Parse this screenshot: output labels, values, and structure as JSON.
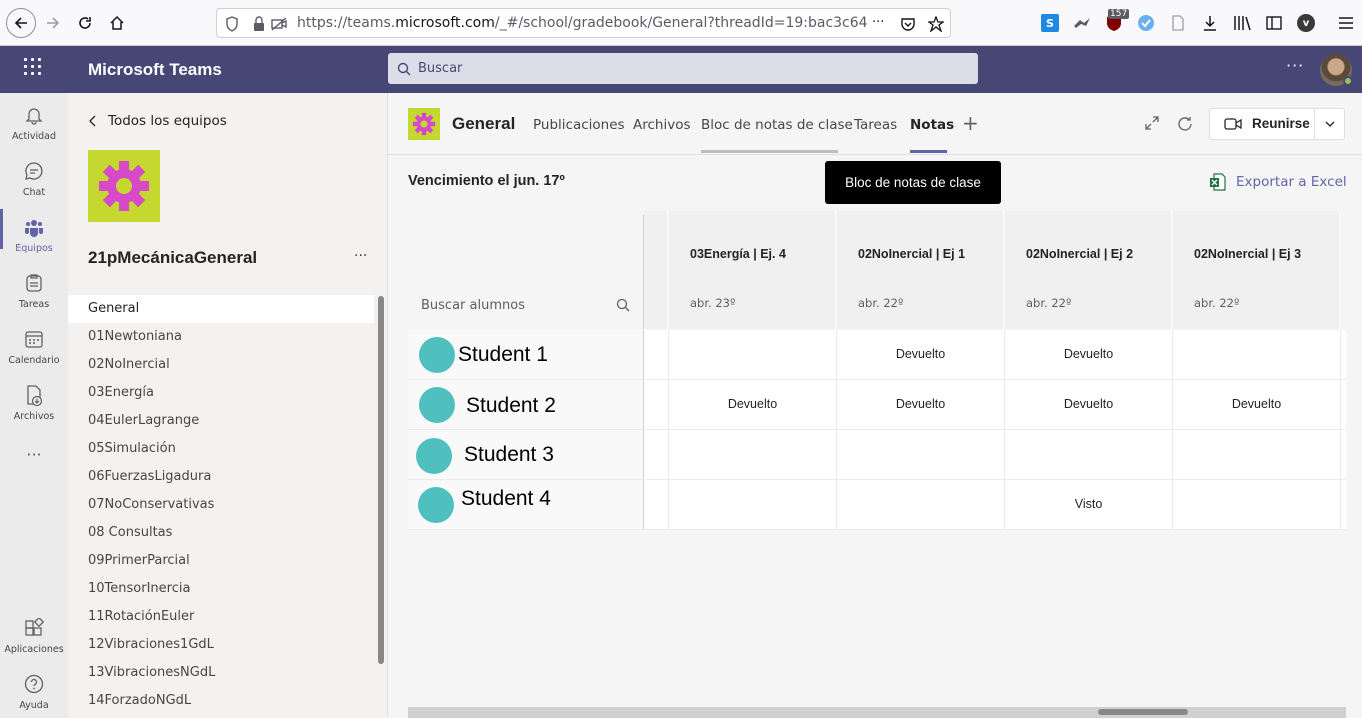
{
  "browser": {
    "url_scheme": "https://teams.",
    "url_domain": "microsoft.com",
    "url_path": "/_#/school/gradebook/General?threadId=19:bac3c64",
    "url_more": "···",
    "badge_count": "157"
  },
  "header": {
    "app_title": "Microsoft Teams",
    "search_placeholder": "Buscar",
    "more": "···"
  },
  "rail": {
    "items": [
      {
        "label": "Actividad"
      },
      {
        "label": "Chat"
      },
      {
        "label": "Equipos"
      },
      {
        "label": "Tareas"
      },
      {
        "label": "Calendario"
      },
      {
        "label": "Archivos"
      },
      {
        "label": "···"
      },
      {
        "label": "Aplicaciones"
      },
      {
        "label": "Ayuda"
      }
    ]
  },
  "team_panel": {
    "back_label": "Todos los equipos",
    "team_name": "21pMecánicaGeneral",
    "more": "···",
    "channels": [
      "General",
      "01Newtoniana",
      "02NoInercial",
      "03Energía",
      "04EulerLagrange",
      "05Simulación",
      "06FuerzasLigadura",
      "07NoConservativas",
      "08 Consultas",
      "09PrimerParcial",
      "10TensorInercia",
      "11RotaciónEuler",
      "12Vibraciones1GdL",
      "13VibracionesNGdL",
      "14ForzadoNGdL"
    ]
  },
  "main": {
    "channel_name": "General",
    "tabs": [
      "Publicaciones",
      "Archivos",
      "Bloc de notas de clase",
      "Tareas",
      "Notas"
    ],
    "active_tab": "Notas",
    "add_tab": "+",
    "meet_label": "Reunirse",
    "tooltip": "Bloc de notas de clase",
    "due_label": "Vencimiento el jun. 17º",
    "export_label": "Exportar a Excel"
  },
  "gradebook": {
    "search_placeholder": "Buscar alumnos",
    "columns": [
      {
        "title": "03Energía | Ej. 4",
        "date": "abr. 23º"
      },
      {
        "title": "02NoInercial | Ej 1",
        "date": "abr. 22º"
      },
      {
        "title": "02NoInercial | Ej 2",
        "date": "abr. 22º"
      },
      {
        "title": "02NoInercial | Ej 3",
        "date": "abr. 22º"
      }
    ],
    "rows": [
      {
        "name": "Student 1",
        "cells": [
          "",
          "Devuelto",
          "Devuelto",
          ""
        ]
      },
      {
        "name": "Student 2",
        "cells": [
          "Devuelto",
          "Devuelto",
          "Devuelto",
          "Devuelto"
        ]
      },
      {
        "name": "Student 3",
        "cells": [
          "",
          "",
          "",
          ""
        ]
      },
      {
        "name": "Student 4",
        "cells": [
          "",
          "",
          "Visto",
          ""
        ]
      }
    ]
  },
  "colors": {
    "brand": "#464775",
    "accent": "#6264a7",
    "team_logo_bg": "#c5d82f",
    "gear": "#d649c8",
    "student_avatar": "#4fbfc0"
  }
}
